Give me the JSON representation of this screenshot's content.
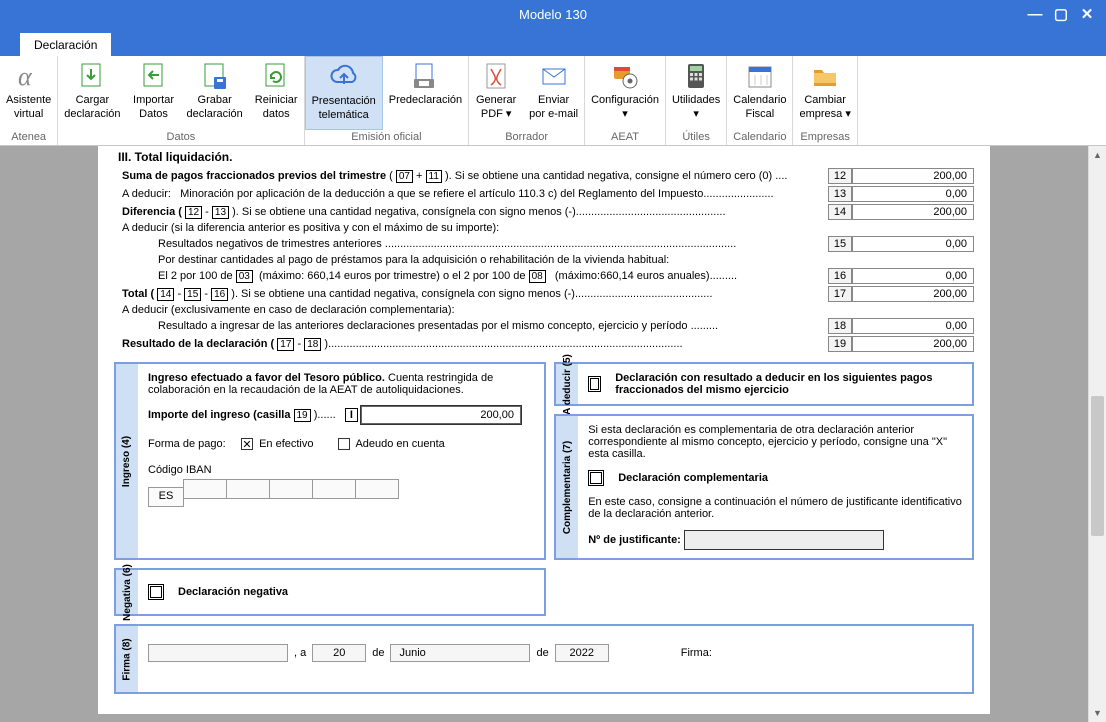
{
  "window": {
    "title": "Modelo 130"
  },
  "tab": {
    "label": "Declaración"
  },
  "ribbon": {
    "groups": [
      {
        "label": "Atenea",
        "items": [
          {
            "name": "asistente-virtual",
            "l1": "Asistente",
            "l2": "virtual",
            "icon": "alpha"
          }
        ]
      },
      {
        "label": "Datos",
        "items": [
          {
            "name": "cargar-declaracion",
            "l1": "Cargar",
            "l2": "declaración",
            "icon": "doc-arrow-down"
          },
          {
            "name": "importar-datos",
            "l1": "Importar",
            "l2": "Datos",
            "icon": "doc-arrow-left"
          },
          {
            "name": "grabar-declaracion",
            "l1": "Grabar",
            "l2": "declaración",
            "icon": "doc-disk"
          },
          {
            "name": "reiniciar-datos",
            "l1": "Reiniciar",
            "l2": "datos",
            "icon": "doc-refresh"
          }
        ]
      },
      {
        "label": "Emisión oficial",
        "items": [
          {
            "name": "presentacion-telematica",
            "l1": "Presentación",
            "l2": "telemática",
            "icon": "cloud-up",
            "selected": true
          },
          {
            "name": "predeclaracion",
            "l1": "Predeclaración",
            "l2": "",
            "icon": "doc-printer"
          }
        ]
      },
      {
        "label": "Borrador",
        "items": [
          {
            "name": "generar-pdf",
            "l1": "Generar",
            "l2": "PDF ▾",
            "icon": "pdf"
          },
          {
            "name": "enviar-email",
            "l1": "Enviar",
            "l2": "por e-mail",
            "icon": "mail"
          }
        ]
      },
      {
        "label": "AEAT",
        "items": [
          {
            "name": "configuracion",
            "l1": "Configuración",
            "l2": "▾",
            "icon": "gear-badge"
          }
        ]
      },
      {
        "label": "Útiles",
        "items": [
          {
            "name": "utilidades",
            "l1": "Utilidades",
            "l2": "▾",
            "icon": "calc"
          }
        ]
      },
      {
        "label": "Calendario",
        "items": [
          {
            "name": "calendario-fiscal",
            "l1": "Calendario",
            "l2": "Fiscal",
            "icon": "calendar"
          }
        ]
      },
      {
        "label": "Empresas",
        "items": [
          {
            "name": "cambiar-empresa",
            "l1": "Cambiar",
            "l2": "empresa ▾",
            "icon": "folder"
          }
        ]
      }
    ]
  },
  "section3": {
    "title": "III.  Total liquidación.",
    "rows": {
      "suma_prefix": "Suma de pagos fraccionados previos del trimestre",
      "suma_b1": "07",
      "suma_b2": "11",
      "suma_suffix": "). Si se obtiene una cantidad negativa, consigne el número cero (0)",
      "r12": {
        "num": "12",
        "val": "200,00"
      },
      "adeducir_label": "A deducir:",
      "adeducir_text": "Minoración por aplicación de la deducción a que se refiere el artículo 110.3 c) del Reglamento del Impuesto",
      "r13": {
        "num": "13",
        "val": "0,00"
      },
      "dif_prefix": "Diferencia (",
      "dif_b1": "12",
      "dif_sep": " - ",
      "dif_b2": "13",
      "dif_suffix": " ). Si se obtiene una cantidad negativa, consígnela con signo menos (-)",
      "r14": {
        "num": "14",
        "val": "200,00"
      },
      "adeducir2": "A deducir (si la diferencia anterior es positiva y con el máximo de su importe):",
      "resneg": "Resultados negativos de trimestres anteriores",
      "r15": {
        "num": "15",
        "val": "0,00"
      },
      "porhab": "Por destinar cantidades al pago de préstamos para la adquisición o rehabilitación de la vivienda habitual:",
      "el2_a": "El 2 por 100 de",
      "el2_b1": "03",
      "el2_mid": "(máximo: 660,14 euros por trimestre) o el 2 por 100 de",
      "el2_b2": "08",
      "el2_end": "(máximo:660,14 euros anuales)",
      "r16": {
        "num": "16",
        "val": "0,00"
      },
      "total_prefix": "Total (",
      "total_b1": "14",
      "total_s1": " - ",
      "total_b2": "15",
      "total_s2": " - ",
      "total_b3": "16",
      "total_suffix": " ). Si se obtiene una cantidad negativa, consígnela con signo menos (-)",
      "r17": {
        "num": "17",
        "val": "200,00"
      },
      "adeducir3": "A deducir (exclusivamente en caso de declaración complementaria):",
      "resing": "Resultado a ingresar de las anteriores declaraciones presentadas por el mismo concepto, ejercicio y período",
      "r18": {
        "num": "18",
        "val": "0,00"
      },
      "resdecl_prefix": "Resultado de la declaración (",
      "resdecl_b1": "17",
      "resdecl_sep": " - ",
      "resdecl_b2": "18",
      "resdecl_suffix": " )",
      "r19": {
        "num": "19",
        "val": "200,00"
      }
    }
  },
  "ingreso": {
    "label": "Ingreso (4)",
    "intro_bold": "Ingreso efectuado a favor del Tesoro público.",
    "intro_rest": " Cuenta restringida de colaboración en la recaudación de la AEAT de autoliquidaciones.",
    "importe_label": "Importe del ingreso (casilla",
    "importe_box": "19",
    "importe_dots": ")......",
    "importe_I": "I",
    "importe_val": "200,00",
    "forma_label": "Forma de pago:",
    "efectivo": "En efectivo",
    "adeudo": "Adeudo en cuenta",
    "iban_label": "Código IBAN",
    "iban_first": "ES"
  },
  "deducir": {
    "label": "A deducir (5)",
    "text": "Declaración con resultado a deducir en los siguientes pagos fraccionados del mismo ejercicio"
  },
  "negativa": {
    "label": "Negativa (6)",
    "text": "Declaración negativa"
  },
  "compl": {
    "label": "Complementaria (7)",
    "intro": "Si esta declaración es complementaria de otra declaración anterior correspondiente al mismo concepto, ejercicio y período, consigne una \"X\" esta casilla.",
    "chk_label": "Declaración complementaria",
    "note": "En este caso, consigne a continuación el número de justificante identificativo de la declaración anterior.",
    "just_label": "Nº de justificante:"
  },
  "firma": {
    "label": "Firma (8)",
    "a": ", a",
    "day": "20",
    "de1": "de",
    "month": "Junio",
    "de2": "de",
    "year": "2022",
    "firma_lbl": "Firma:"
  }
}
